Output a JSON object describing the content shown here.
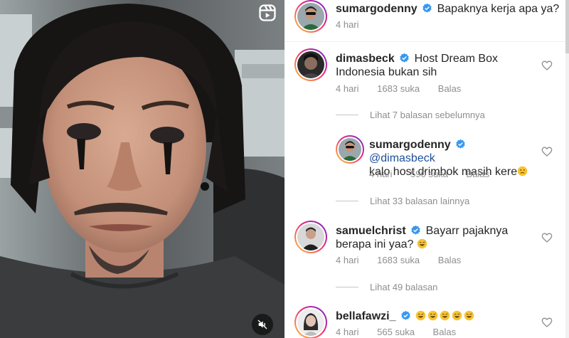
{
  "colors": {
    "accent_link": "#1d4f9a",
    "verified_badge": "#3897f0",
    "muted_text": "#8e8e8e"
  },
  "video": {
    "reel_icon": "reels-icon",
    "mute_icon": "muted-speaker-icon"
  },
  "comments": [
    {
      "username": "sumargodenny",
      "verified": true,
      "text": "Bapaknya kerja apa ya?",
      "time": "4 hari",
      "likes": "",
      "reply": ""
    },
    {
      "username": "dimasbeck",
      "verified": true,
      "text": "Host Dream Box Indonesia bukan sih",
      "time": "4 hari",
      "likes": "1683 suka",
      "reply": "Balas"
    },
    {
      "username": "sumargodenny",
      "verified": true,
      "mention": "@dimasbeck",
      "text": "kalo host drimbok masih kere",
      "emoji": "sad-face-emoji",
      "time": "4 hari",
      "likes": "590 suka",
      "reply": "Balas"
    },
    {
      "username": "samuelchrist",
      "verified": true,
      "text": "Bayarr pajaknya berapa ini yaa?",
      "emoji": "sweat-smile-emoji",
      "time": "4 hari",
      "likes": "1683 suka",
      "reply": "Balas"
    },
    {
      "username": "bellafawzi_",
      "verified": true,
      "text": "",
      "emoji_count": 5,
      "emoji": "grinning-sweat-emoji",
      "time": "4 hari",
      "likes": "565 suka",
      "reply": "Balas"
    }
  ],
  "view_replies": [
    "Lihat 7 balasan sebelumnya",
    "Lihat 33 balasan lainnya",
    "Lihat 49 balasan"
  ]
}
